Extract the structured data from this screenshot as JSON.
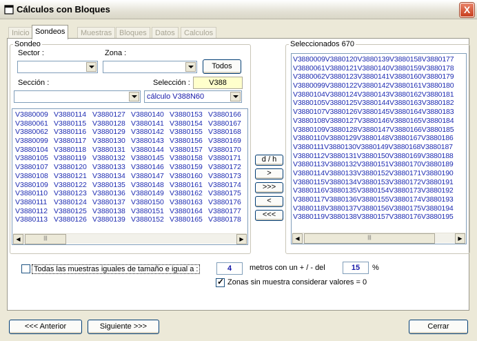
{
  "window": {
    "title": "Cálculos con Bloques",
    "close_label": "X"
  },
  "tabs": [
    "Inicio",
    "Sondeos",
    "Muestras",
    "Bloques",
    "Datos",
    "Calculos"
  ],
  "sondeo": {
    "legend": "Sondeo",
    "sector_label": "Sector :",
    "zona_label": "Zona :",
    "todos_label": "Todos",
    "seccion_label": "Sección :",
    "seleccion_label": "Selección :",
    "seleccion_value": "V388",
    "calculo_value": "cálculo V388N60",
    "list_rows": [
      [
        "V3880009",
        "V3880114",
        "V3880127",
        "V3880140",
        "V3880153",
        "V3880166"
      ],
      [
        "V3880061",
        "V3880115",
        "V3880128",
        "V3880141",
        "V3880154",
        "V3880167"
      ],
      [
        "V3880062",
        "V3880116",
        "V3880129",
        "V3880142",
        "V3880155",
        "V3880168"
      ],
      [
        "V3880099",
        "V3880117",
        "V3880130",
        "V3880143",
        "V3880156",
        "V3880169"
      ],
      [
        "V3880104",
        "V3880118",
        "V3880131",
        "V3880144",
        "V3880157",
        "V3880170"
      ],
      [
        "V3880105",
        "V3880119",
        "V3880132",
        "V3880145",
        "V3880158",
        "V3880171"
      ],
      [
        "V3880107",
        "V3880120",
        "V3880133",
        "V3880146",
        "V3880159",
        "V3880172"
      ],
      [
        "V3880108",
        "V3880121",
        "V3880134",
        "V3880147",
        "V3880160",
        "V3880173"
      ],
      [
        "V3880109",
        "V3880122",
        "V3880135",
        "V3880148",
        "V3880161",
        "V3880174"
      ],
      [
        "V3880110",
        "V3880123",
        "V3880136",
        "V3880149",
        "V3880162",
        "V3880175"
      ],
      [
        "V3880111",
        "V3880124",
        "V3880137",
        "V3880150",
        "V3880163",
        "V3880176"
      ],
      [
        "V3880112",
        "V3880125",
        "V3880138",
        "V3880151",
        "V3880164",
        "V3880177"
      ],
      [
        "V3880113",
        "V3880126",
        "V3880139",
        "V3880152",
        "V3880165",
        "V3880178"
      ]
    ]
  },
  "transfer": {
    "dh": "d / h",
    "one_right": ">",
    "all_right": ">>>",
    "one_left": "<",
    "all_left": "<<<"
  },
  "seleccionados": {
    "legend": "Seleccionados 670",
    "rows": [
      "V3880009V3880120V3880139V3880158V3880177",
      "V3880061V3880121V3880140V3880159V3880178",
      "V3880062V3880123V3880141V3880160V3880179",
      "V3880099V3880122V3880142V3880161V3880180",
      "V3880104V3880124V3880143V3880162V3880181",
      "V3880105V3880125V3880144V3880163V3880182",
      "V3880107V3880126V3880145V3880164V3880183",
      "V3880108V3880127V3880146V3880165V3880184",
      "V3880109V3880128V3880147V3880166V3880185",
      "V3880110V3880129V3880148V3880167V3880186",
      "V3880111V3880130V3880149V3880168V3880187",
      "V3880112V3880131V3880150V3880169V3880188",
      "V3880113V3880132V3880151V3880170V3880189",
      "V3880114V3880133V3880152V3880171V3880190",
      "V3880115V3880134V3880153V3880172V3880191",
      "V3880116V3880135V3880154V3880173V3880192",
      "V3880117V3880136V3880155V3880174V3880193",
      "V3880118V3880137V3880156V3880175V3880194",
      "V3880119V3880138V3880157V3880176V3880195"
    ]
  },
  "options": {
    "todas_label": "Todas las muestras iguales de tamaño e igual a :",
    "todas_checked": false,
    "metros_value": "4",
    "metros_label": "metros con un + / - del",
    "pct_value": "15",
    "pct_symbol": "%",
    "zonas_label": "Zonas sin muestra considerar valores = 0",
    "zonas_checked": true
  },
  "footer": {
    "anterior": "<<< Anterior",
    "siguiente": "Siguiente >>>",
    "cerrar": "Cerrar"
  },
  "icons": {
    "scroll_left": "◀",
    "scroll_right": "▶",
    "check_mark": "✓"
  }
}
